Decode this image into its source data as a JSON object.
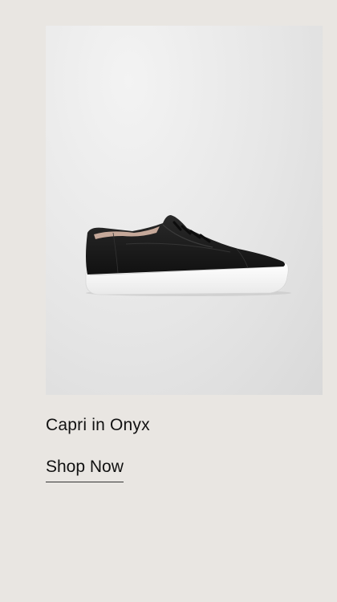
{
  "product": {
    "name": "Capri in Onyx",
    "image_alt": "Black leather low-top sneaker with white sole",
    "cta_label": "Shop Now"
  },
  "colors": {
    "page_background": "#e9e6e2",
    "image_background": "#e4e4e4",
    "shoe_upper": "#1b1b1b",
    "shoe_sole": "#ffffff",
    "text": "#111111"
  }
}
